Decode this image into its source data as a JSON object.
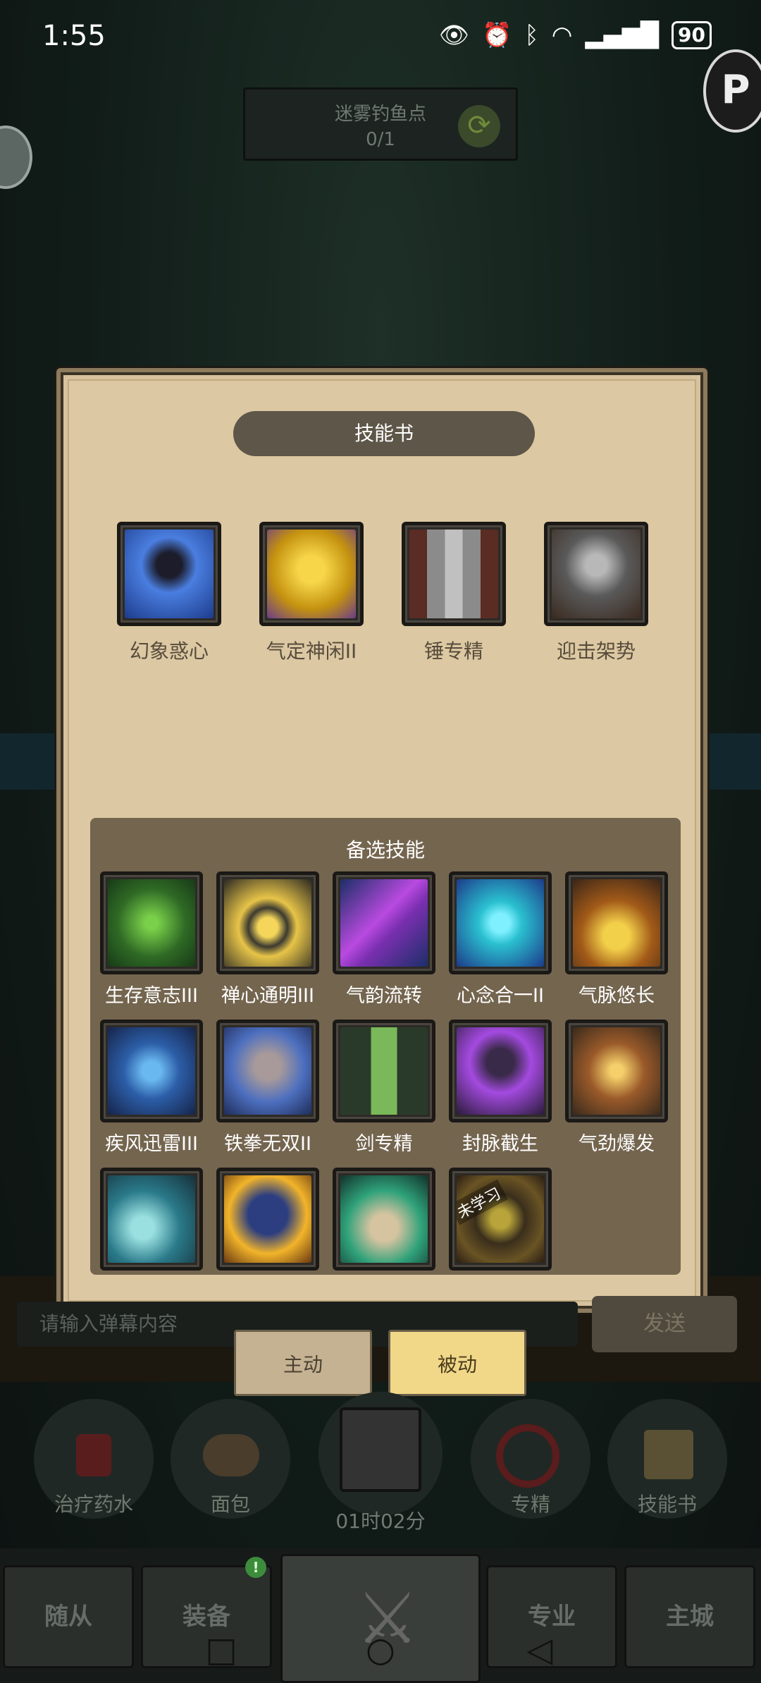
{
  "status_bar": {
    "time": "1:55",
    "battery": "90"
  },
  "quest": {
    "title": "迷雾钓鱼点",
    "progress": "0/1"
  },
  "side_right_letter": "P",
  "dialog": {
    "title": "技能书",
    "learned_skills": [
      {
        "label": "幻象惑心",
        "icon": "phantom-icon"
      },
      {
        "label": "气定神闲II",
        "icon": "golden-body-icon"
      },
      {
        "label": "锤专精",
        "icon": "hammer-icon"
      },
      {
        "label": "迎击架势",
        "icon": "armored-knight-icon"
      }
    ],
    "alternatives_title": "备选技能",
    "alternative_skills": [
      {
        "label": "生存意志III",
        "icon": "vines-icon"
      },
      {
        "label": "禅心通明III",
        "icon": "spiral-icon"
      },
      {
        "label": "气韵流转",
        "icon": "purple-swirl-icon"
      },
      {
        "label": "心念合一II",
        "icon": "cyan-crystal-icon"
      },
      {
        "label": "气脉悠长",
        "icon": "golden-flame-icon"
      },
      {
        "label": "疾风迅雷III",
        "icon": "blue-rune-icon"
      },
      {
        "label": "铁拳无双II",
        "icon": "fist-icon"
      },
      {
        "label": "剑专精",
        "icon": "sword-icon"
      },
      {
        "label": "封脉截生",
        "icon": "chained-figure-icon"
      },
      {
        "label": "气劲爆发",
        "icon": "burst-sword-icon"
      },
      {
        "label": "",
        "icon": "water-wave-icon"
      },
      {
        "label": "",
        "icon": "eagle-icon"
      },
      {
        "label": "",
        "icon": "green-hand-icon"
      },
      {
        "label": "",
        "icon": "eye-sun-icon",
        "badge": "未学习"
      }
    ]
  },
  "chat": {
    "placeholder": "请输入弹幕内容",
    "send": "发送"
  },
  "tabs": {
    "active": "主动",
    "passive": "被动"
  },
  "dock": {
    "items": [
      "治疗药水",
      "面包",
      "专精",
      "技能书"
    ],
    "timer": "01时02分"
  },
  "nav": {
    "items": [
      "随从",
      "装备",
      "专业",
      "主城"
    ],
    "badge": "!"
  }
}
